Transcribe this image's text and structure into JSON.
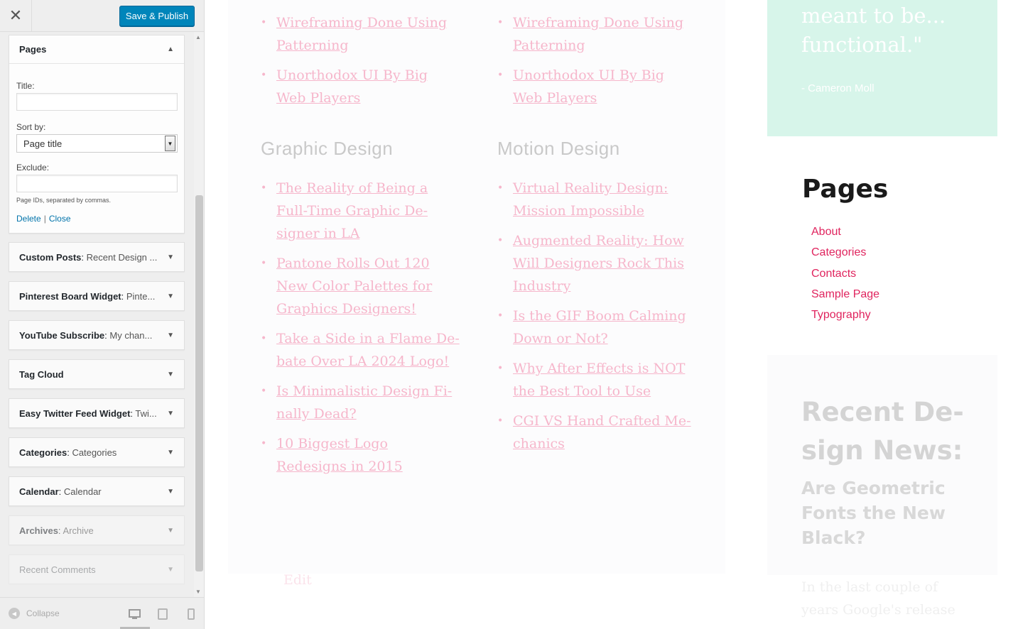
{
  "sidebar": {
    "close_glyph": "✕",
    "publish_label": "Save & Publish",
    "pages_widget": {
      "title": "Pages",
      "title_label": "Title:",
      "title_value": "",
      "sort_label": "Sort by:",
      "sort_value": "Page title",
      "exclude_label": "Exclude:",
      "exclude_value": "",
      "exclude_hint": "Page IDs, separated by commas.",
      "delete_label": "Delete",
      "link_separator": "|",
      "close_label": "Close"
    },
    "widgets": [
      {
        "name": "Custom Posts",
        "sub": "Recent Design ..."
      },
      {
        "name": "Pinterest Board Widget",
        "sub": "Pinte..."
      },
      {
        "name": "YouTube Subscribe",
        "sub": "My chan..."
      },
      {
        "name": "Tag Cloud",
        "sub": ""
      },
      {
        "name": "Easy Twitter Feed Widget",
        "sub": "Twi..."
      },
      {
        "name": "Categories",
        "sub": "Categories"
      },
      {
        "name": "Calendar",
        "sub": "Calendar"
      },
      {
        "name": "Archives",
        "sub": "Archive"
      },
      {
        "name": "Recent Comments",
        "sub": ""
      }
    ],
    "name_separator": ": ",
    "collapse_label": "Collapse",
    "devices": [
      "desktop-icon",
      "tablet-icon",
      "mobile-icon"
    ]
  },
  "preview": {
    "col1_top": [
      "Wireframing Done Using Patterning",
      "Unorthodox UI By Big Web Players"
    ],
    "col2_top": [
      "Wireframing Done Using Patterning",
      "Unorthodox UI By Big Web Players"
    ],
    "graphic_design": {
      "heading": "Graphic Design",
      "posts": [
        "The Reality of Being a Full-Time Graphic De-signer in LA",
        "Pantone Rolls Out 120 New Color Palettes for Graphics Designers!",
        "Take a Side in a Flame De-bate Over LA 2024 Logo!",
        "Is Minimalistic Design Fi-nally Dead?",
        "10 Biggest Logo Redesigns in 2015"
      ]
    },
    "motion_design": {
      "heading": "Motion Design",
      "posts": [
        "Virtual Reality Design: Mission Impossible",
        "Augmented Reality: How Will Designers Rock This Industry",
        "Is the GIF Boom Calming Down or Not?",
        "Why After Effects is NOT the Best Tool to Use",
        "CGI VS Hand Crafted Me-chanics"
      ]
    },
    "edit_label": "Edit",
    "quote": {
      "text": "meant to be... functional.\"",
      "author": "- Cameron Moll"
    },
    "pages_widget": {
      "title": "Pages",
      "items": [
        "About",
        "Categories",
        "Contacts",
        "Sample Page",
        "Typography"
      ]
    },
    "news": {
      "title": "Recent De-sign News:",
      "subtitle": "Are Geometric Fonts the New Black?",
      "excerpt": "In the last couple of years Google's release"
    },
    "colors": {
      "accent": "#e0245e",
      "publish_button": "#0085ba",
      "quote_bg": "#d7f5ea"
    }
  }
}
